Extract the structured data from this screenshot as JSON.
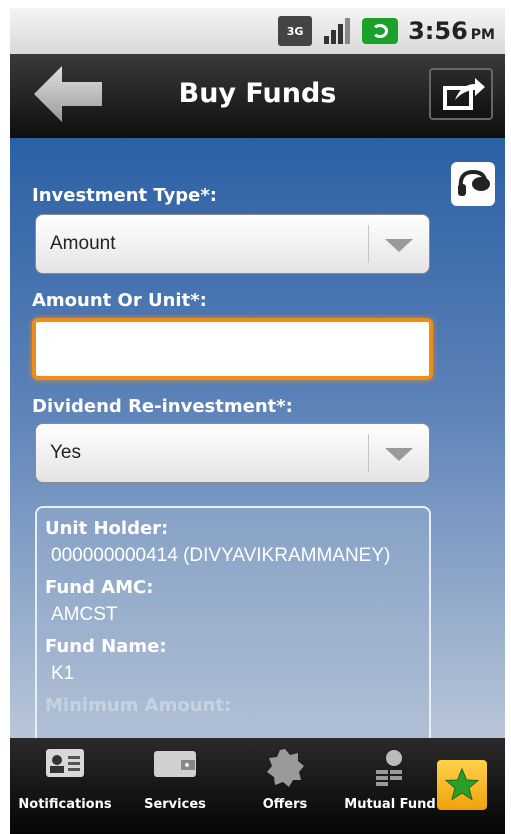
{
  "status_bar": {
    "network": "3G",
    "time": "3:56",
    "ampm": "PM"
  },
  "header": {
    "title": "Buy Funds"
  },
  "form": {
    "investment_type_label": "Investment Type*:",
    "investment_type_value": "Amount",
    "amount_label": "Amount Or Unit*:",
    "amount_value": "",
    "dividend_label": "Dividend Re-investment*:",
    "dividend_value": "Yes"
  },
  "info": {
    "unit_holder_label": "Unit Holder:",
    "unit_holder_value": "000000000414  (DIVYAVIKRAMMANEY)",
    "fund_amc_label": "Fund AMC:",
    "fund_amc_value": "AMCST",
    "fund_name_label": "Fund Name:",
    "fund_name_value": "K1",
    "minimum_amount_label": "Minimum Amount:"
  },
  "tabs": [
    {
      "label": "Notifications",
      "icon": "contact-card-icon"
    },
    {
      "label": "Services",
      "icon": "wallet-icon"
    },
    {
      "label": "Offers",
      "icon": "offer-badge-icon"
    },
    {
      "label": "Mutual Fund",
      "icon": "money-bag-icon"
    }
  ],
  "colors": {
    "accent_focus": "#f08c1a",
    "header": "#1a1a1a",
    "content_top": "#2b60a5",
    "favorite": "#f5b320"
  }
}
